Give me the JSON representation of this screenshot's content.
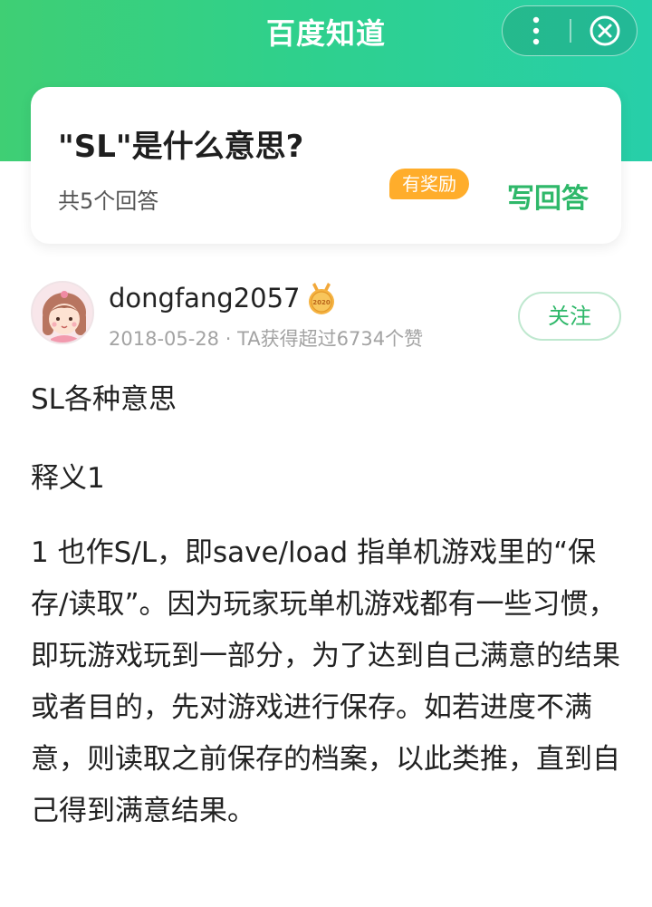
{
  "header": {
    "app_title": "百度知道",
    "more_icon": "more-vertical-icon",
    "close_icon": "close-circle-icon",
    "gradient_colors": [
      "#3fcf74",
      "#27cfa9"
    ]
  },
  "question": {
    "title": "\"SL\"是什么意思?",
    "answer_count": "共5个回答",
    "reward_badge": "有奖励",
    "write_answer": "写回答",
    "accent_color": "#2fb86a",
    "badge_color": "#ffad2b"
  },
  "answer": {
    "username": "dongfang2057",
    "medal_icon": "medal-2020-icon",
    "medal_text": "2020",
    "meta": "2018-05-28 · TA获得超过6734个赞",
    "follow_label": "关注",
    "paragraphs": [
      "SL各种意思",
      "释义1",
      "1 也作S/L，即save/load 指单机游戏里的“保存/读取”。因为玩家玩单机游戏都有一些习惯，即玩游戏玩到一部分，为了达到自己满意的结果或者目的，先对游戏进行保存。如若进度不满意，则读取之前保存的档案，以此类推，直到自己得到满意结果。"
    ]
  }
}
